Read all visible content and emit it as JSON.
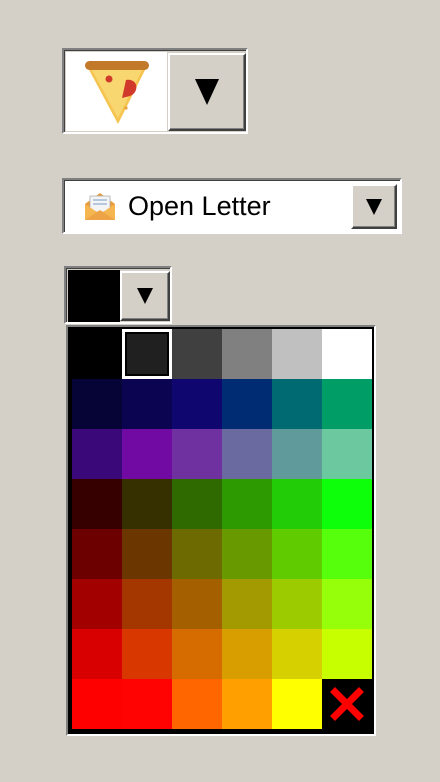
{
  "icon_picker": {
    "selected_icon": "pizza-slice-icon",
    "dropdown_icon": "triangle-down-icon"
  },
  "template_picker": {
    "icon": "open-envelope-icon",
    "label": "Open Letter",
    "dropdown_icon": "triangle-down-icon"
  },
  "color_picker": {
    "current_color": "#000000",
    "dropdown_icon": "triangle-down-icon"
  },
  "palette": {
    "selected_index": 1,
    "clear_icon": "red-x-icon",
    "rows": [
      [
        "#000000",
        "#202020",
        "#404040",
        "#808080",
        "#c0c0c0",
        "#ffffff"
      ],
      [
        "#060436",
        "#0b0450",
        "#100670",
        "#002c74",
        "#006a72",
        "#009e66"
      ],
      [
        "#3a0878",
        "#700aa2",
        "#6f30a0",
        "#6a6aa0",
        "#609a9a",
        "#6cc89e"
      ],
      [
        "#360000",
        "#363000",
        "#2e6a00",
        "#2c9a00",
        "#22cc06",
        "#0eff0a"
      ],
      [
        "#6c0000",
        "#6c3600",
        "#6c6a00",
        "#689a00",
        "#60cc00",
        "#56ff0c"
      ],
      [
        "#a20000",
        "#a43600",
        "#a46000",
        "#a29a00",
        "#9ccc00",
        "#96ff0a"
      ],
      [
        "#d80000",
        "#d83800",
        "#d66c00",
        "#d89e00",
        "#d6d000",
        "#c8ff00"
      ],
      [
        "#ff0000",
        "#ff0202",
        "#ff6600",
        "#ffa000",
        "#ffff00",
        "clear"
      ]
    ]
  }
}
